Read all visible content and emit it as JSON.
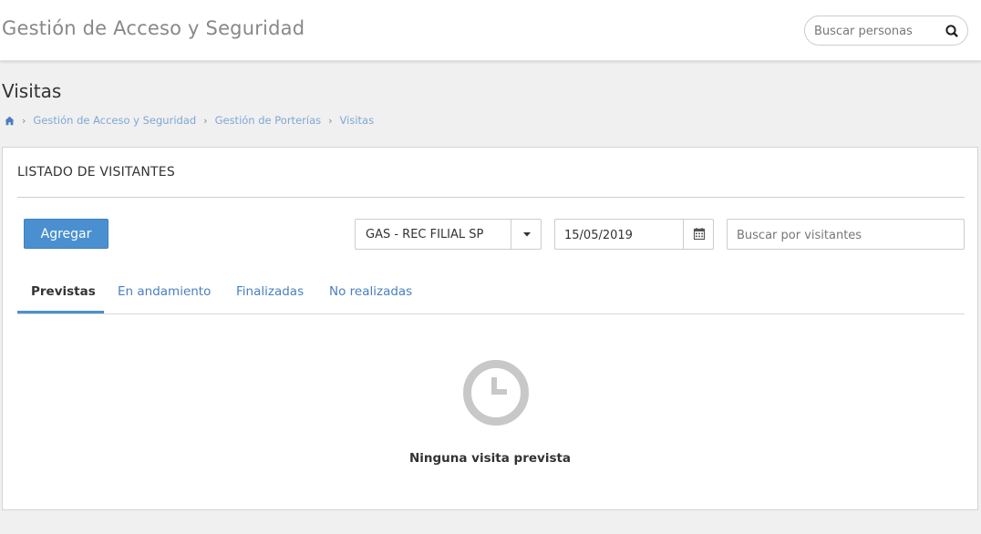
{
  "header": {
    "app_title": "Gestión de Acceso y Seguridad",
    "search": {
      "placeholder": "Buscar personas",
      "icon": "search-icon"
    }
  },
  "page": {
    "title": "Visitas",
    "breadcrumb": {
      "home_icon": "home-icon",
      "items": [
        "Gestión de Acceso y Seguridad",
        "Gestión de Porterías",
        "Visitas"
      ]
    }
  },
  "panel": {
    "title": "LISTADO DE VISITANTES",
    "add_button": "Agregar",
    "branch_select": {
      "value": "GAS - REC FILIAL SP",
      "icon": "chevron-down-icon"
    },
    "date": {
      "value": "15/05/2019",
      "icon": "calendar-icon"
    },
    "visitor_search": {
      "placeholder": "Buscar por visitantes"
    },
    "tabs": [
      {
        "label": "Previstas",
        "active": true
      },
      {
        "label": "En andamiento",
        "active": false
      },
      {
        "label": "Finalizadas",
        "active": false
      },
      {
        "label": "No realizadas",
        "active": false
      }
    ],
    "empty_state": {
      "icon": "clock-icon",
      "message": "Ninguna visita prevista"
    }
  },
  "colors": {
    "accent": "#4a90d0",
    "link": "#4a7fbf",
    "breadcrumb_link": "#7ea8d4",
    "background": "#f0f0f0",
    "empty_icon": "#c8c8c8"
  }
}
